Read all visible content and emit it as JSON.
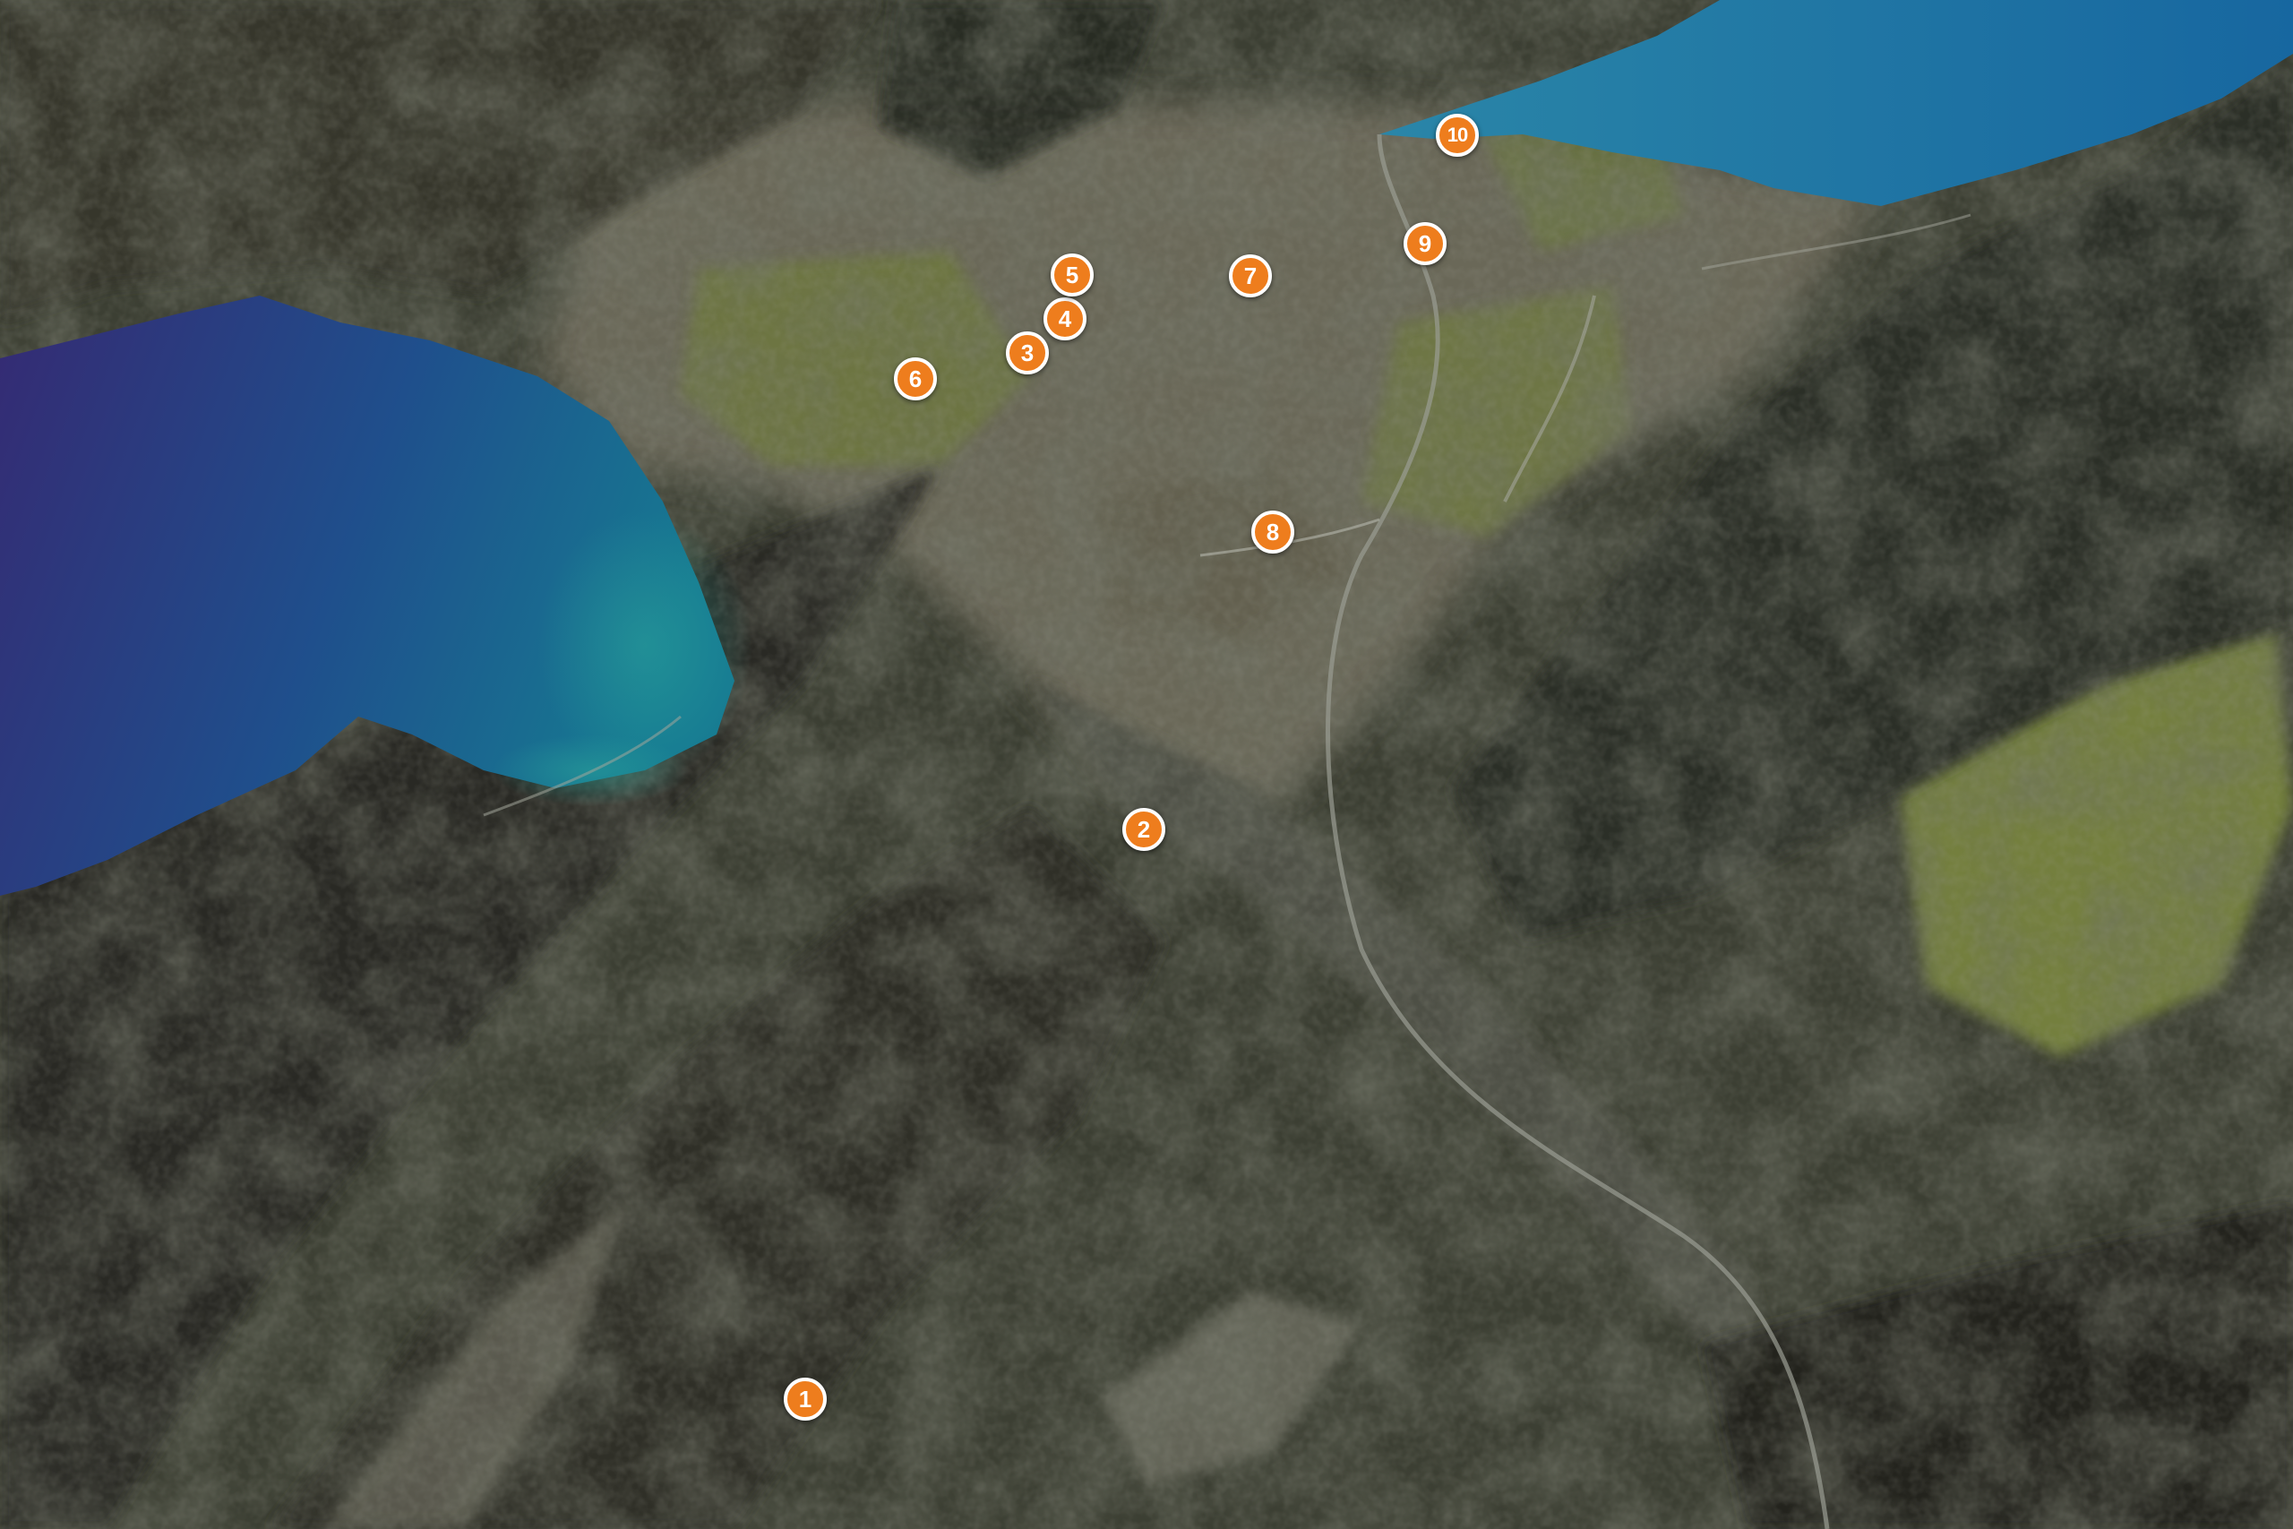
{
  "colors": {
    "lake_left": "#2f2f6e",
    "lake_right": "#1a6e9b",
    "marker_fill": "#ee7d1d",
    "marker_border": "#ffffff",
    "valley_town": "#6b6a5c",
    "meadow": "#7d8a3c",
    "mountain_dark": "#2a2c25"
  },
  "markers": [
    {
      "label": "1"
    },
    {
      "label": "2"
    },
    {
      "label": "3"
    },
    {
      "label": "4"
    },
    {
      "label": "5"
    },
    {
      "label": "6"
    },
    {
      "label": "7"
    },
    {
      "label": "8"
    },
    {
      "label": "9"
    },
    {
      "label": "10"
    }
  ]
}
